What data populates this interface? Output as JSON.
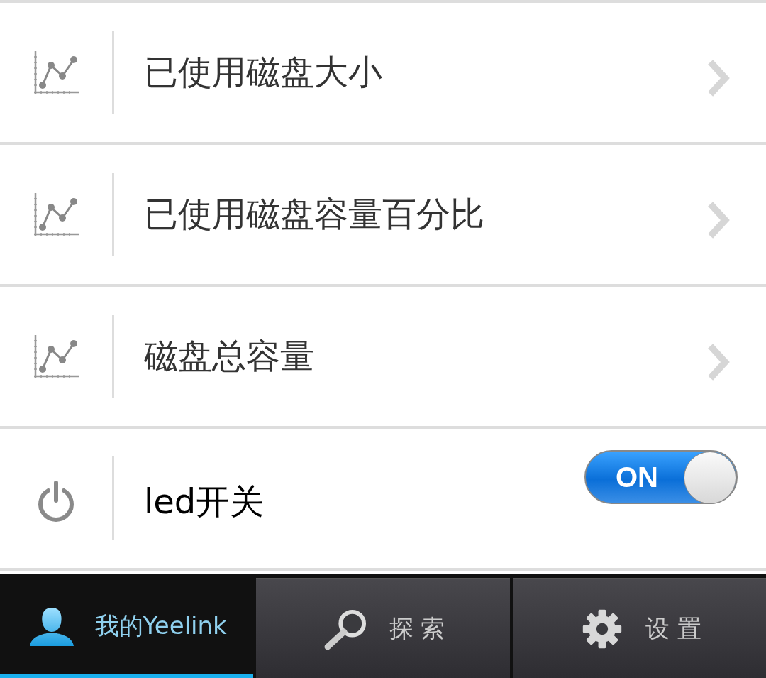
{
  "items": [
    {
      "kind": "chart",
      "label": "已使用磁盘大小"
    },
    {
      "kind": "chart",
      "label": "已使用磁盘容量百分比"
    },
    {
      "kind": "chart",
      "label": "磁盘总容量"
    },
    {
      "kind": "switch",
      "label": "led开关",
      "switch": {
        "label": "ON",
        "on": true
      }
    }
  ],
  "tabs": [
    {
      "kind": "user",
      "label": "我的Yeelink",
      "selected": true
    },
    {
      "kind": "search",
      "label": "探 索",
      "selected": false
    },
    {
      "kind": "settings",
      "label": "设 置",
      "selected": false
    }
  ]
}
